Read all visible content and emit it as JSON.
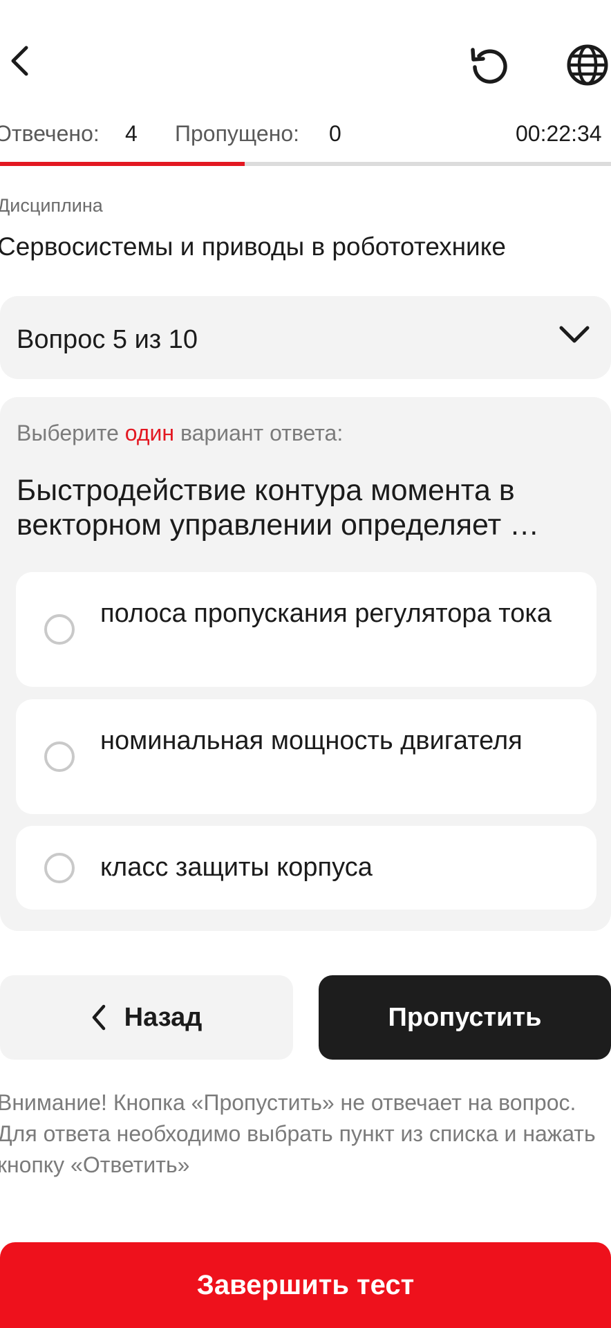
{
  "header": {
    "back_icon": "chevron-left-icon",
    "reset_icon": "restart-icon",
    "language_icon": "globe-icon"
  },
  "stats": {
    "answered_label": "Отвечено:",
    "answered_value": "4",
    "skipped_label": "Пропущено:",
    "skipped_value": "0",
    "timer": "00:22:34"
  },
  "progress": {
    "fraction": 0.4,
    "color": "#e31822"
  },
  "discipline": {
    "label": "Дисциплина",
    "name": "Сервосистемы и приводы в робототехнике"
  },
  "question_selector": {
    "label": "Вопрос 5 из 10"
  },
  "question": {
    "instruction_prefix": "Выберите",
    "instruction_accent": "один",
    "instruction_suffix": "вариант ответа:",
    "text": "Быстродействие контура момента в векторном управлении определяет …",
    "options": [
      {
        "label": "полоса пропускания регулятора тока",
        "selected": false
      },
      {
        "label": "номинальная мощность двигателя",
        "selected": false
      },
      {
        "label": "класс защиты корпуса",
        "selected": false
      }
    ]
  },
  "buttons": {
    "back_label": "Назад",
    "skip_label": "Пропустить",
    "finish_label": "Завершить тест"
  },
  "notice": "Внимание! Кнопка «Пропустить» не отвечает на вопрос. Для ответа необходимо выбрать пункт из списка и нажать кнопку «Ответить»",
  "colors": {
    "accent": "#e31822",
    "finish_button": "#ee111c",
    "skip_button": "#1d1d1d"
  }
}
